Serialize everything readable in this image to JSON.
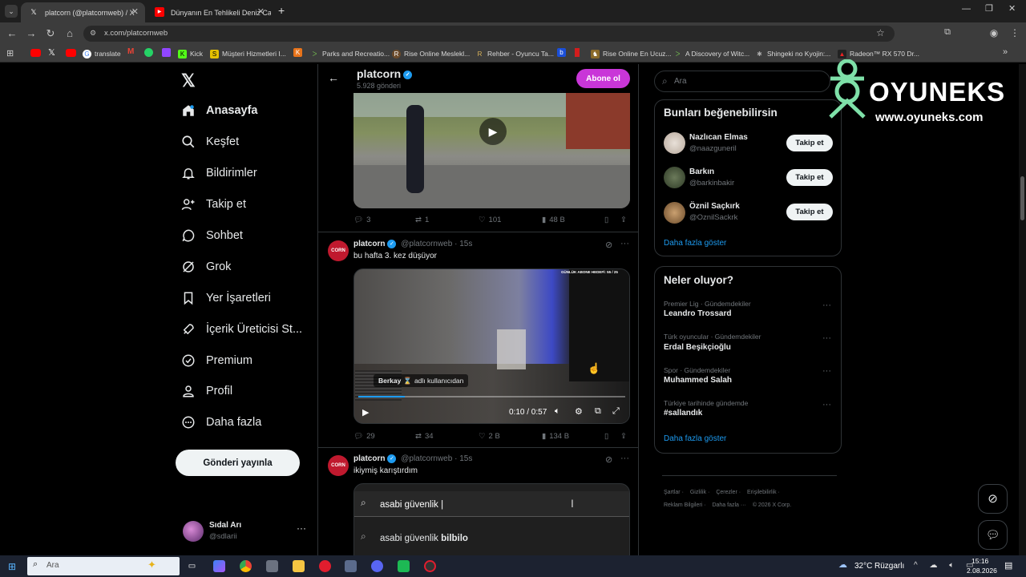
{
  "browser": {
    "tabs": [
      {
        "title": "platcorn (@platcornweb) / X",
        "active": true
      },
      {
        "title": "Dünyanın En Tehlikeli Deniz Can",
        "active": false
      }
    ],
    "new_tab": "+",
    "url": "x.com/platcornweb",
    "bookmarks": [
      "translate",
      "Kick",
      "Müşteri Hizmetleri I...",
      "Parks and Recreatio...",
      "Rise Online Meslekl...",
      "Rehber - Oyuncu Ta...",
      "Rise Online En Ucuz...",
      "A Discovery of Witc...",
      "Shingeki no Kyojin:...",
      "Radeon™ RX 570 Dr..."
    ]
  },
  "nav": {
    "items": [
      "Anasayfa",
      "Keşfet",
      "Bildirimler",
      "Takip et",
      "Sohbet",
      "Grok",
      "Yer İşaretleri",
      "İçerik Üreticisi St...",
      "Premium",
      "Profil",
      "Daha fazla"
    ],
    "post_button": "Gönderi yayınla",
    "user": {
      "name": "Sıdal Arı",
      "handle": "@sdlarii"
    }
  },
  "profile_header": {
    "name": "platcorn",
    "posts": "5.928 gönderi",
    "subscribe": "Abone ol"
  },
  "tweets": [
    {
      "stats": {
        "replies": "3",
        "retweets": "1",
        "likes": "101",
        "views": "48 B"
      }
    },
    {
      "author": "platcorn",
      "handle": "@platcornweb",
      "time": "· 15s",
      "text": "bu hafta 3. kez düşüyor",
      "video": {
        "overlay_top": "GÜNLÜK ABONE HEDEFİ: 55 / 25",
        "caption_name": "Berkay",
        "caption_rest": "adlı kullanıcıdan",
        "time": "0:10 / 0:57",
        "progress": 0.175
      },
      "stats": {
        "replies": "29",
        "retweets": "34",
        "likes": "2 B",
        "views": "134 B"
      }
    },
    {
      "author": "platcorn",
      "handle": "@platcornweb",
      "time": "· 15s",
      "text": "ikiymiş karıştırdım",
      "search_query": "asabi güvenlik |",
      "suggestion_plain": "asabi güvenlik",
      "suggestion_bold": "bilbilo"
    }
  ],
  "right": {
    "search_placeholder": "Ara",
    "who_title": "Bunları beğenebilirsin",
    "who": [
      {
        "name": "Nazlıcan Elmas",
        "handle": "@naazguneril",
        "btn": "Takip et"
      },
      {
        "name": "Barkın",
        "handle": "@barkinbakir",
        "btn": "Takip et"
      },
      {
        "name": "Öznil Saçkırk",
        "handle": "@OznilSackrk",
        "btn": "Takip et"
      }
    ],
    "show_more": "Daha fazla göster",
    "trends_title": "Neler oluyor?",
    "trends": [
      {
        "meta": "Premier Lig · Gündemdekiler",
        "name": "Leandro Trossard"
      },
      {
        "meta": "Türk oyuncular · Gündemdekiler",
        "name": "Erdal Beşikçioğlu"
      },
      {
        "meta": "Spor · Gündemdekiler",
        "name": "Muhammed Salah"
      },
      {
        "meta": "Türkiye tarihinde gündemde",
        "name": "#sallandık"
      }
    ],
    "show_more2": "Daha fazla göster",
    "footer": [
      "Şartlar",
      "Gizlilik",
      "Çerezler",
      "Erişilebilirlik",
      "Reklam Bilgileri",
      "Daha fazla ···",
      "© 2026 X Corp."
    ]
  },
  "watermark": {
    "brand": "OYUNEKS",
    "url": "www.oyuneks.com"
  },
  "taskbar": {
    "search": "Ara",
    "weather": "32°C",
    "weather_text": "Rüzgarlı",
    "time": "15:16",
    "date": "2.08.2026"
  }
}
